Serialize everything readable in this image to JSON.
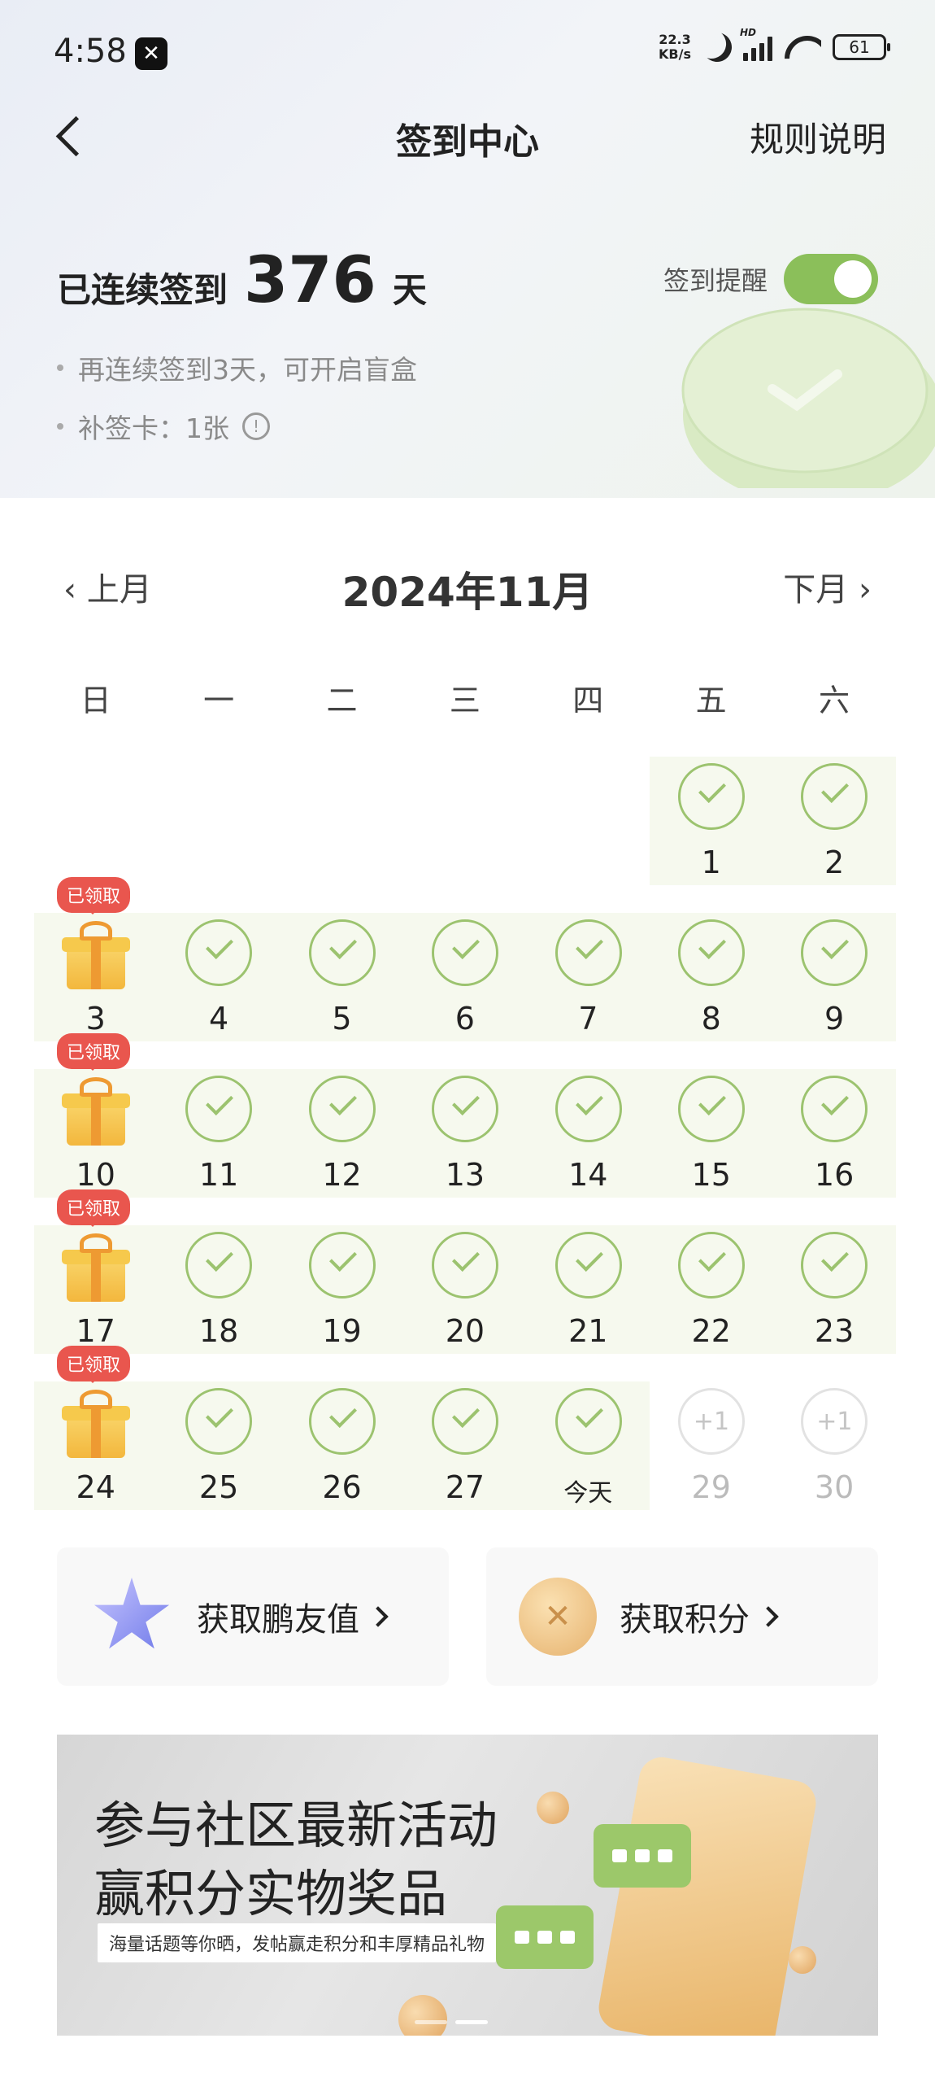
{
  "status_bar": {
    "time": "4:58",
    "app_icon": "✕",
    "net_speed_value": "22.3",
    "net_speed_unit": "KB/s",
    "hd_label": "HD",
    "battery": "61"
  },
  "header": {
    "title": "签到中心",
    "rules_link": "规则说明"
  },
  "streak": {
    "prefix": "已连续签到",
    "days": "376",
    "suffix": "天",
    "reminder_label": "签到提醒",
    "reminder_on": true,
    "tips": [
      "再连续签到3天，可开启盲盒",
      "补签卡：1张"
    ]
  },
  "calendar": {
    "prev_label": "上月",
    "next_label": "下月",
    "month_title": "2024年11月",
    "weekdays": [
      "日",
      "一",
      "二",
      "三",
      "四",
      "五",
      "六"
    ],
    "claimed_label": "已领取",
    "days": [
      {
        "label": "1",
        "state": "checked"
      },
      {
        "label": "2",
        "state": "checked"
      },
      {
        "label": "3",
        "state": "gift"
      },
      {
        "label": "4",
        "state": "checked"
      },
      {
        "label": "5",
        "state": "checked"
      },
      {
        "label": "6",
        "state": "checked"
      },
      {
        "label": "7",
        "state": "checked"
      },
      {
        "label": "8",
        "state": "checked"
      },
      {
        "label": "9",
        "state": "checked"
      },
      {
        "label": "10",
        "state": "gift"
      },
      {
        "label": "11",
        "state": "checked"
      },
      {
        "label": "12",
        "state": "checked"
      },
      {
        "label": "13",
        "state": "checked"
      },
      {
        "label": "14",
        "state": "checked"
      },
      {
        "label": "15",
        "state": "checked"
      },
      {
        "label": "16",
        "state": "checked"
      },
      {
        "label": "17",
        "state": "gift"
      },
      {
        "label": "18",
        "state": "checked"
      },
      {
        "label": "19",
        "state": "checked"
      },
      {
        "label": "20",
        "state": "checked"
      },
      {
        "label": "21",
        "state": "checked"
      },
      {
        "label": "22",
        "state": "checked"
      },
      {
        "label": "23",
        "state": "checked"
      },
      {
        "label": "24",
        "state": "gift"
      },
      {
        "label": "25",
        "state": "checked"
      },
      {
        "label": "26",
        "state": "checked"
      },
      {
        "label": "27",
        "state": "checked"
      },
      {
        "label": "今天",
        "state": "today"
      },
      {
        "label": "29",
        "state": "future",
        "reward": "+1"
      },
      {
        "label": "30",
        "state": "future",
        "reward": "+1"
      }
    ]
  },
  "cards": [
    {
      "label": "获取鹏友值",
      "icon": "star-icon"
    },
    {
      "label": "获取积分",
      "icon": "coin-icon"
    }
  ],
  "banner": {
    "title_line1": "参与社区最新活动",
    "title_line2": "赢积分实物奖品",
    "subtitle": "海量话题等你晒，发帖赢走积分和丰厚精品礼物"
  },
  "colors": {
    "accent_green": "#8bbf5a",
    "badge_red": "#e9564e",
    "band_green": "#f6f9ee"
  }
}
